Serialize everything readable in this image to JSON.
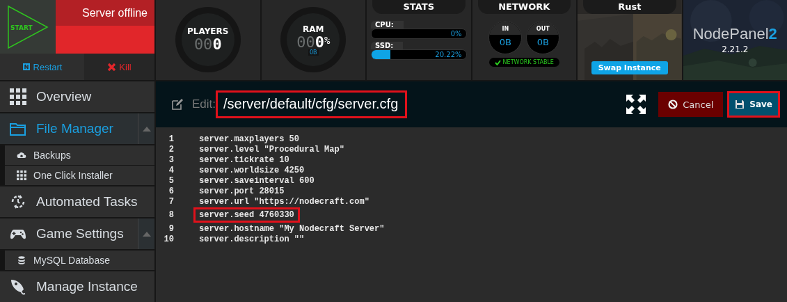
{
  "control": {
    "start_label": "START",
    "status": "Server offline",
    "restart": "Restart",
    "kill": "Kill"
  },
  "gauges": [
    {
      "label": "PLAYERS",
      "dim_digits": "00",
      "value": "0"
    },
    {
      "label": "RAM",
      "dim_digits": "00",
      "value": "0",
      "unit": "%",
      "detail": "0B"
    }
  ],
  "stats": {
    "title": "STATS",
    "bars": [
      {
        "label": "CPU:",
        "level": 0,
        "reading": "0%"
      },
      {
        "label": "SSD:",
        "level": 0.2022,
        "reading": "20.22%"
      }
    ]
  },
  "network": {
    "title": "NETWORK",
    "meters": [
      {
        "label": "IN",
        "value": "0B"
      },
      {
        "label": "OUT",
        "value": "0B"
      }
    ],
    "status": "NETWORK STABLE"
  },
  "game": {
    "title": "Rust",
    "button": "Swap Instance"
  },
  "brand": {
    "name": "NodePanel",
    "mark": "2",
    "version": "2.21.2"
  },
  "sidebar": {
    "items": [
      {
        "label": "Overview",
        "selected": false
      },
      {
        "label": "File Manager",
        "selected": true,
        "expanded": true,
        "children": [
          {
            "label": "Backups",
            "selected": false
          },
          {
            "label": "One Click Installer",
            "selected": false
          }
        ]
      },
      {
        "label": "Automated Tasks",
        "selected": false
      },
      {
        "label": "Game Settings",
        "selected": false,
        "expanded": true,
        "children": [
          {
            "label": "MySQL Database",
            "selected": false
          }
        ]
      },
      {
        "label": "Manage Instance",
        "selected": false
      }
    ]
  },
  "editor": {
    "edit_label": "Edit:",
    "path": "/server/default/cfg/server.cfg",
    "path_highlighted": true,
    "cancel": "Cancel",
    "save": "Save",
    "save_highlighted": true,
    "lines": [
      {
        "number": "1",
        "text": "server.maxplayers 50",
        "highlighted": false
      },
      {
        "number": "2",
        "text": "server.level \"Procedural Map\"",
        "highlighted": false
      },
      {
        "number": "3",
        "text": "server.tickrate 10",
        "highlighted": false
      },
      {
        "number": "4",
        "text": "server.worldsize 4250",
        "highlighted": false
      },
      {
        "number": "5",
        "text": "server.saveinterval 600",
        "highlighted": false
      },
      {
        "number": "6",
        "text": "server.port 28015",
        "highlighted": false
      },
      {
        "number": "7",
        "text": "server.url \"https://nodecraft.com\"",
        "highlighted": false
      },
      {
        "number": "8",
        "text": "server.seed 4760330",
        "highlighted": true
      },
      {
        "number": "9",
        "text": "server.hostname \"My Nodecraft Server\"",
        "highlighted": false
      },
      {
        "number": "10",
        "text": "server.description \"\"",
        "highlighted": false
      }
    ]
  }
}
